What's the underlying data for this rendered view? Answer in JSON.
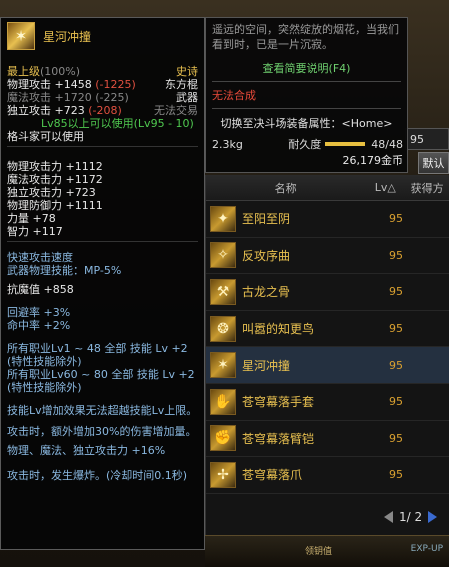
{
  "item": {
    "name": "星河冲撞",
    "level_label": "最上级",
    "level_pct": "(100%)",
    "rarity": "史诗",
    "phys_atk": "物理攻击 +1458",
    "phys_atk_diff": "(-1225)",
    "type": "东方棍",
    "mag_atk": "魔法攻击 +1720",
    "mag_atk_diff": "(-225)",
    "category": "武器",
    "ind_atk": "独立攻击 +723",
    "ind_atk_diff": "(-208)",
    "trade": "无法交易",
    "req_level": "Lv85以上可以使用",
    "req_level_range": "(Lv95 - 10)",
    "class_req": "格斗家可以使用",
    "stats": [
      "物理攻击力 +1112",
      "魔法攻击力 +1172",
      "独立攻击力 +723",
      "物理防御力 +1111",
      "力量 +78",
      "智力 +117"
    ],
    "speed_1": "快速攻击速度",
    "speed_2": "武器物理技能：MP-5%",
    "anti_magic": "抗魔值 +858",
    "evasion": "回避率 +3%",
    "hit": "命中率 +2%",
    "skill_1": "所有职业Lv1 ~ 48 全部 技能 Lv +2",
    "skill_1b": "(特性技能除外)",
    "skill_2": "所有职业Lv60 ~ 80 全部 技能 Lv +2",
    "skill_2b": "(特性技能除外)",
    "skill_lv": "技能Lv增加效果无法超越技能Lv上限。",
    "effect_1": "攻击时，额外增加30%的伤害增加量。",
    "effect_2": "物理、魔法、独立攻击力 +16%",
    "effect_3": "攻击时，发生爆炸。(冷却时间0.1秒)"
  },
  "tip2": {
    "desc": "遥远的空间，突然绽放的烟花，当我们看到时，已是一片沉寂。",
    "link": "查看简要说明(F4)",
    "no_combine": "无法合成",
    "switch": "切换至决斗场装备属性：<Home>",
    "weight": "2.3kg",
    "durability_label": "耐久度",
    "durability": "48/48",
    "gold": "26,179金币"
  },
  "list": {
    "header_name": "名称",
    "header_lv": "Lv△",
    "header_get": "获得方",
    "rows": [
      {
        "name": "至阳至阴",
        "lv": "95"
      },
      {
        "name": "反攻序曲",
        "lv": "95"
      },
      {
        "name": "古龙之骨",
        "lv": "95"
      },
      {
        "name": "叫嚣的知更鸟",
        "lv": "95"
      },
      {
        "name": "星河冲撞",
        "lv": "95"
      },
      {
        "name": "苍穹幕落手套",
        "lv": "95"
      },
      {
        "name": "苍穹幕落臂铠",
        "lv": "95"
      },
      {
        "name": "苍穹幕落爪",
        "lv": "95"
      }
    ],
    "page": "1/ 2"
  },
  "misc": {
    "top_input": "95",
    "default_btn": "默认",
    "mode": "领钥值",
    "exp": "EXP-UP"
  }
}
